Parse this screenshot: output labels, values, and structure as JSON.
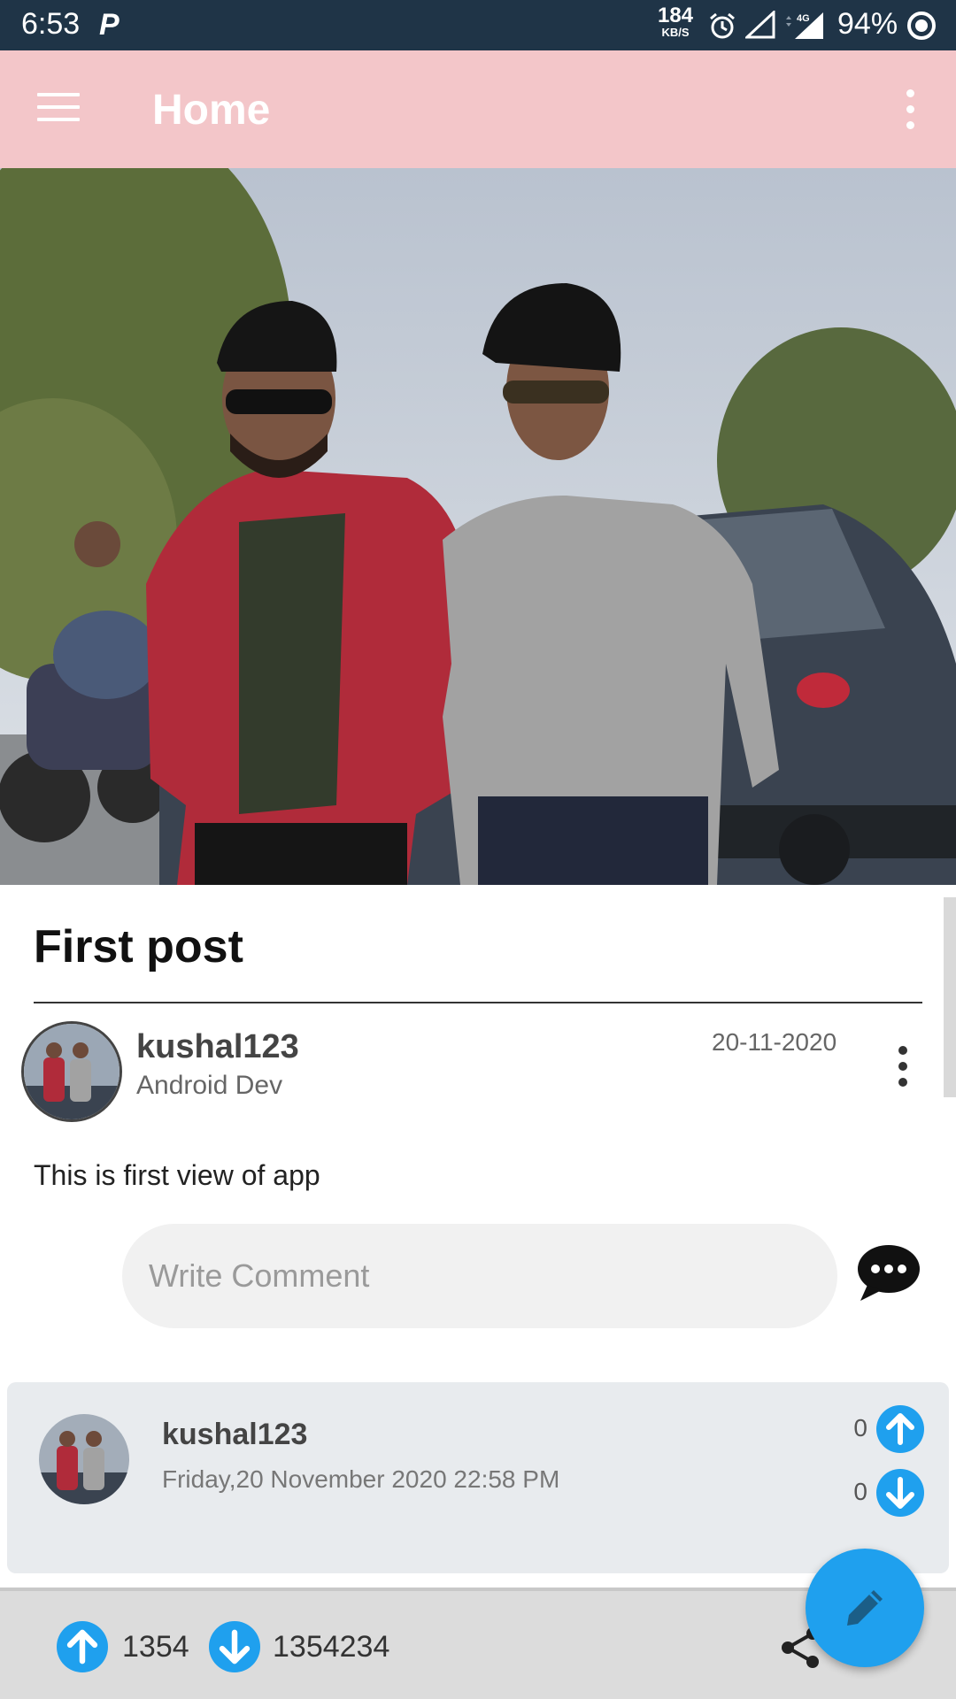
{
  "status_bar": {
    "time": "6:53",
    "notification_icon": "parking-app-icon",
    "net_speed_value": "184",
    "net_speed_unit": "KB/S",
    "network_type": "4G",
    "battery": "94%",
    "icons": [
      "alarm-icon",
      "signal-icon",
      "battery-icon"
    ]
  },
  "app_bar": {
    "title": "Home",
    "background": "#f3c6c9",
    "icons": [
      "hamburger-menu-icon",
      "overflow-menu-icon"
    ]
  },
  "post": {
    "title": "First post",
    "author": "kushal123",
    "author_role": "Android Dev",
    "date": "20-11-2020",
    "body": "This is first view of app",
    "comment_placeholder": "Write Comment",
    "icons": [
      "post-options-icon",
      "comment-send-icon"
    ]
  },
  "comment": {
    "author": "kushal123",
    "timestamp": "Friday,20 November 2020 22:58 PM",
    "upvotes": "0",
    "downvotes": "0"
  },
  "bottom_bar": {
    "upvotes": "1354",
    "downvotes": "1354234",
    "icons": [
      "upvote-icon",
      "downvote-icon",
      "share-icon",
      "edit-icon"
    ]
  },
  "colors": {
    "accent": "#1fa0ee",
    "status_bar": "#1f3447",
    "comment_card": "#e8ebee",
    "bottom_bar": "#dcdcdc"
  }
}
